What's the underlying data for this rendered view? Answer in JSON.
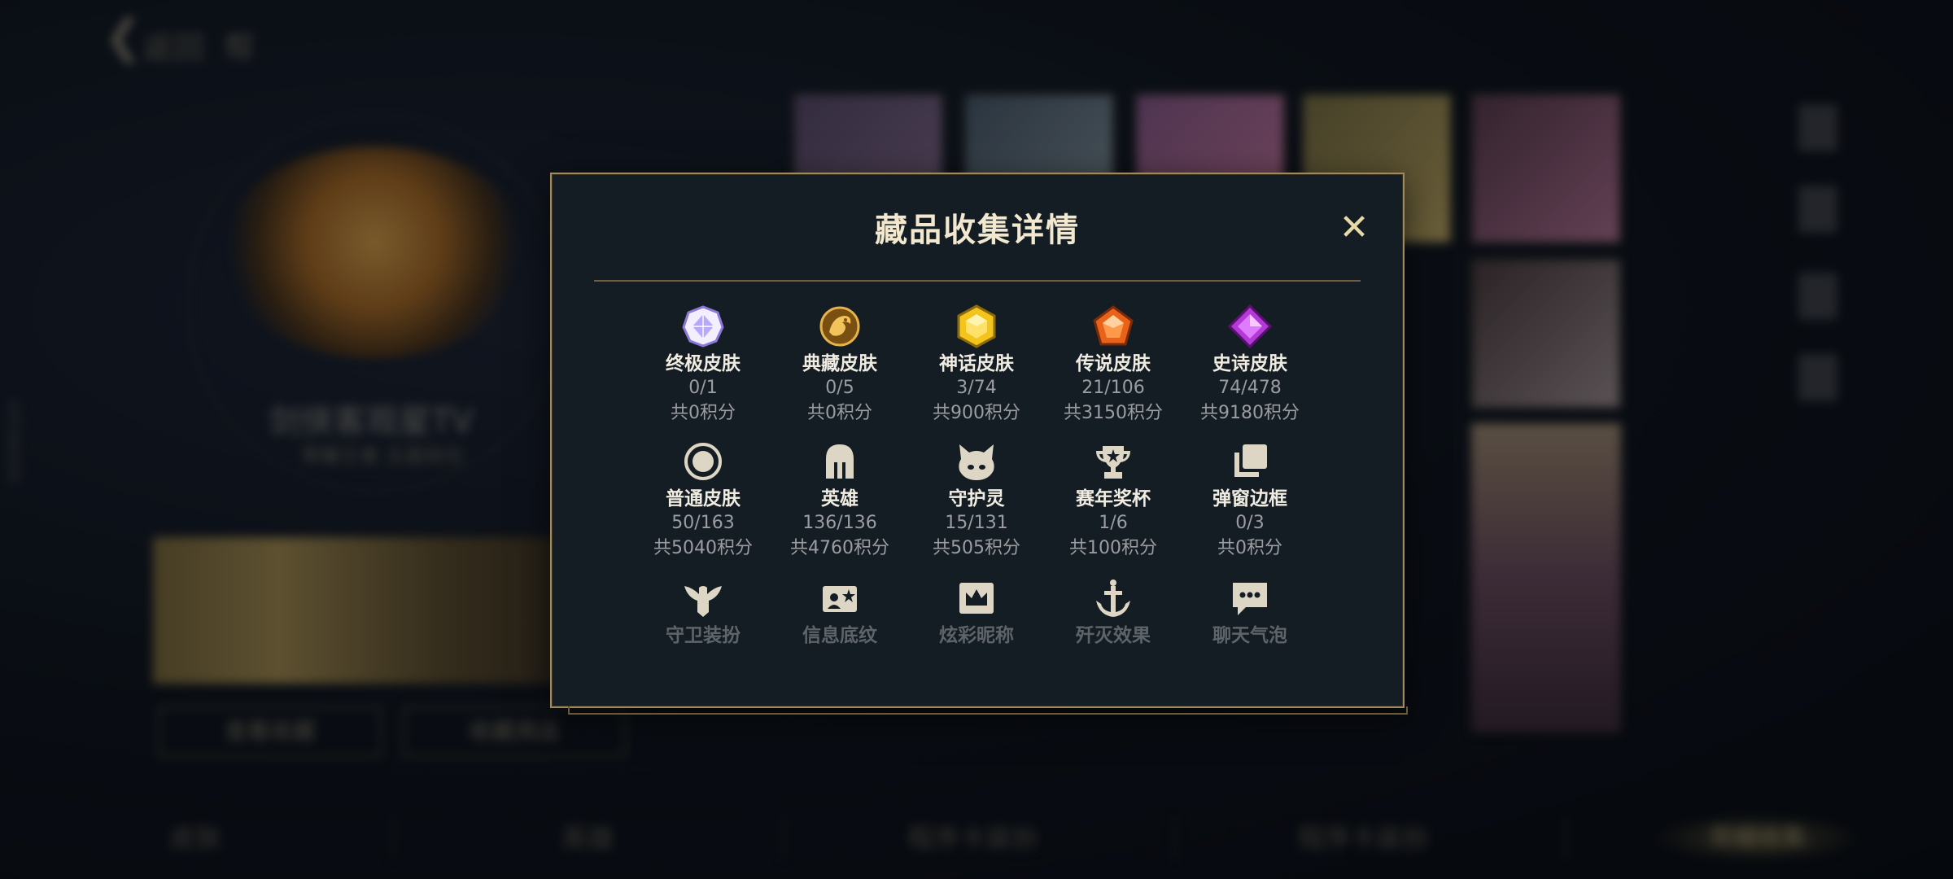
{
  "background": {
    "back_label": "返回",
    "help_label": "帮",
    "player_name": "剑侠客观星TV",
    "player_sub": "荣耀王者 五星段位",
    "btn_left": "查看收藏",
    "btn_right": "收藏商店",
    "side_id": "147284505",
    "bottom_tabs": [
      "皮肤",
      "英雄",
      "程序卡装扮",
      "程序卡装扮",
      "荣耀收集"
    ]
  },
  "dialog": {
    "title": "藏品收集详情",
    "close_symbol": "✕",
    "rows": [
      [
        {
          "name": "终极皮肤",
          "count": "0/1",
          "points": "共0积分",
          "icon": "ultimate-skin-gem",
          "color": "#b8a6ff"
        },
        {
          "name": "典藏皮肤",
          "count": "0/5",
          "points": "共0积分",
          "icon": "collection-skin-dragon",
          "color": "#d7a43a"
        },
        {
          "name": "神话皮肤",
          "count": "3/74",
          "points": "共900积分",
          "icon": "mythic-skin-gem",
          "color": "#f0c21a"
        },
        {
          "name": "传说皮肤",
          "count": "21/106",
          "points": "共3150积分",
          "icon": "legend-skin-gem",
          "color": "#e8621a"
        },
        {
          "name": "史诗皮肤",
          "count": "74/478",
          "points": "共9180积分",
          "icon": "epic-skin-gem",
          "color": "#b43ad8"
        }
      ],
      [
        {
          "name": "普通皮肤",
          "count": "50/163",
          "points": "共5040积分",
          "icon": "normal-skin-circle",
          "color": "#ddd6c4"
        },
        {
          "name": "英雄",
          "count": "136/136",
          "points": "共4760积分",
          "icon": "hero-helmet",
          "color": "#ddd6c4"
        },
        {
          "name": "守护灵",
          "count": "15/131",
          "points": "共505积分",
          "icon": "guardian-spirit",
          "color": "#ddd6c4"
        },
        {
          "name": "赛年奖杯",
          "count": "1/6",
          "points": "共100积分",
          "icon": "season-trophy",
          "color": "#ddd6c4"
        },
        {
          "name": "弹窗边框",
          "count": "0/3",
          "points": "共0积分",
          "icon": "popup-frame",
          "color": "#ddd6c4"
        }
      ],
      [
        {
          "name": "守卫装扮",
          "icon": "guard-outfit",
          "color": "#ddd6c4"
        },
        {
          "name": "信息底纹",
          "icon": "info-background",
          "color": "#ddd6c4"
        },
        {
          "name": "炫彩昵称",
          "icon": "colorful-nickname",
          "color": "#ddd6c4"
        },
        {
          "name": "歼灭效果",
          "icon": "annihilation-effect",
          "color": "#ddd6c4"
        },
        {
          "name": "聊天气泡",
          "icon": "chat-bubble",
          "color": "#ddd6c4"
        }
      ]
    ]
  }
}
